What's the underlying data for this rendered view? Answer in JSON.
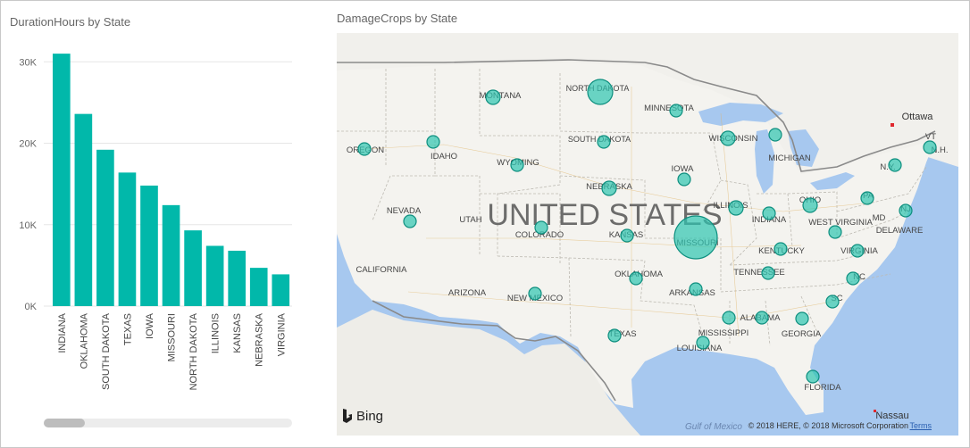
{
  "bar_title": "DurationHours by State",
  "map_title": "DamageCrops by State",
  "bar_color": "#01b8aa",
  "bubble_fill": "#2ec4b0",
  "bubble_stroke": "#0e8f7f",
  "chart_data": {
    "type": "bar",
    "title": "DurationHours by State",
    "categories": [
      "INDIANA",
      "OKLAHOMA",
      "SOUTH DAKOTA",
      "TEXAS",
      "IOWA",
      "MISSOURI",
      "NORTH DAKOTA",
      "ILLINOIS",
      "KANSAS",
      "NEBRASKA",
      "VIRGINIA"
    ],
    "values": [
      31000,
      23600,
      19200,
      16400,
      14800,
      12400,
      9300,
      7400,
      6800,
      4700,
      3900
    ],
    "ylim": [
      0,
      32000
    ],
    "yticks": [
      0,
      10000,
      20000,
      30000
    ],
    "ytick_labels": [
      "0K",
      "10K",
      "20K",
      "30K"
    ],
    "grid": true
  },
  "map": {
    "country_label": "UNITED STATES",
    "state_labels": [
      "MONTANA",
      "NORTH DAKOTA",
      "MINNESOTA",
      "OREGON",
      "IDAHO",
      "SOUTH DAKOTA",
      "WISCONSIN",
      "MICHIGAN",
      "WYOMING",
      "IOWA",
      "NEBRASKA",
      "ILLINOIS",
      "INDIANA",
      "OHIO",
      "NEVADA",
      "UTAH",
      "COLORADO",
      "KANSAS",
      "MISSOURI",
      "WEST VIRGINIA",
      "KENTUCKY",
      "VIRGINIA",
      "CALIFORNIA",
      "TENNESSEE",
      "OKLAHOMA",
      "ARKANSAS",
      "NC",
      "SC",
      "ARIZONA",
      "NEW MEXICO",
      "MISSISSIPPI",
      "ALABAMA",
      "GEORGIA",
      "TEXAS",
      "LOUISIANA",
      "FLORIDA",
      "PA",
      "MD",
      "DELAWARE",
      "NJ",
      "N.Y.",
      "VT",
      "N.H."
    ],
    "city_labels": [
      "Ottawa",
      "Nassau"
    ],
    "water_label": "Gulf of Mexico",
    "bing_label": "Bing",
    "copyright": "© 2018 HERE, © 2018 Microsoft Corporation",
    "terms": "Terms"
  }
}
